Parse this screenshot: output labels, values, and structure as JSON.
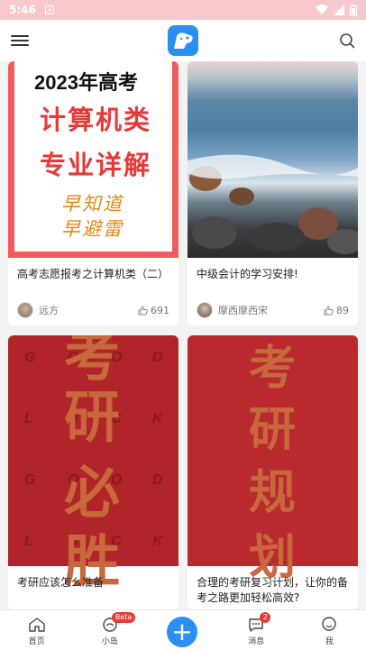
{
  "status_bar": {
    "time": "5:46",
    "notif_glyph": "A"
  },
  "app_bar": {
    "menu_icon": "menu-icon",
    "logo_icon": "app-logo-icon",
    "search_icon": "search-icon"
  },
  "cards": [
    {
      "title": "高考志愿报考之计算机类（二）",
      "author": "远方",
      "likes": "691",
      "poster": {
        "line1": "2023年高考",
        "line2": "计算机类",
        "line3": "专业详解",
        "hand1": "早知道",
        "hand2": "早避雷"
      }
    },
    {
      "title": "中级会计的学习安排!",
      "author": "摩西摩西宋",
      "likes": "89"
    },
    {
      "title": "考研应该怎么准备",
      "poster": {
        "chars": [
          "考",
          "研",
          "必",
          "胜"
        ],
        "letters": [
          "G",
          "O",
          "O",
          "D",
          "L",
          "U",
          "C",
          "K",
          "G",
          "O",
          "O",
          "D",
          "L",
          "U",
          "C",
          "K"
        ]
      }
    },
    {
      "title": "合理的考研复习计划，让你的备考之路更加轻松高效?",
      "poster": {
        "chars": [
          "考",
          "研",
          "规",
          "划"
        ]
      }
    }
  ],
  "bottom_nav": {
    "items": [
      {
        "label": "首页",
        "icon": "home-icon"
      },
      {
        "label": "小岛",
        "icon": "island-chat-icon",
        "badge": "Beta"
      },
      {
        "label": "消息",
        "icon": "message-icon",
        "badge": "2"
      },
      {
        "label": "我",
        "icon": "profile-icon"
      }
    ],
    "fab_icon": "plus-icon",
    "fab_glyph": "+"
  },
  "colors": {
    "accent": "#2a8ff2",
    "status_bar": "#f7c9cc",
    "poster_red": "#b0242a",
    "badge": "#e63a3a"
  }
}
